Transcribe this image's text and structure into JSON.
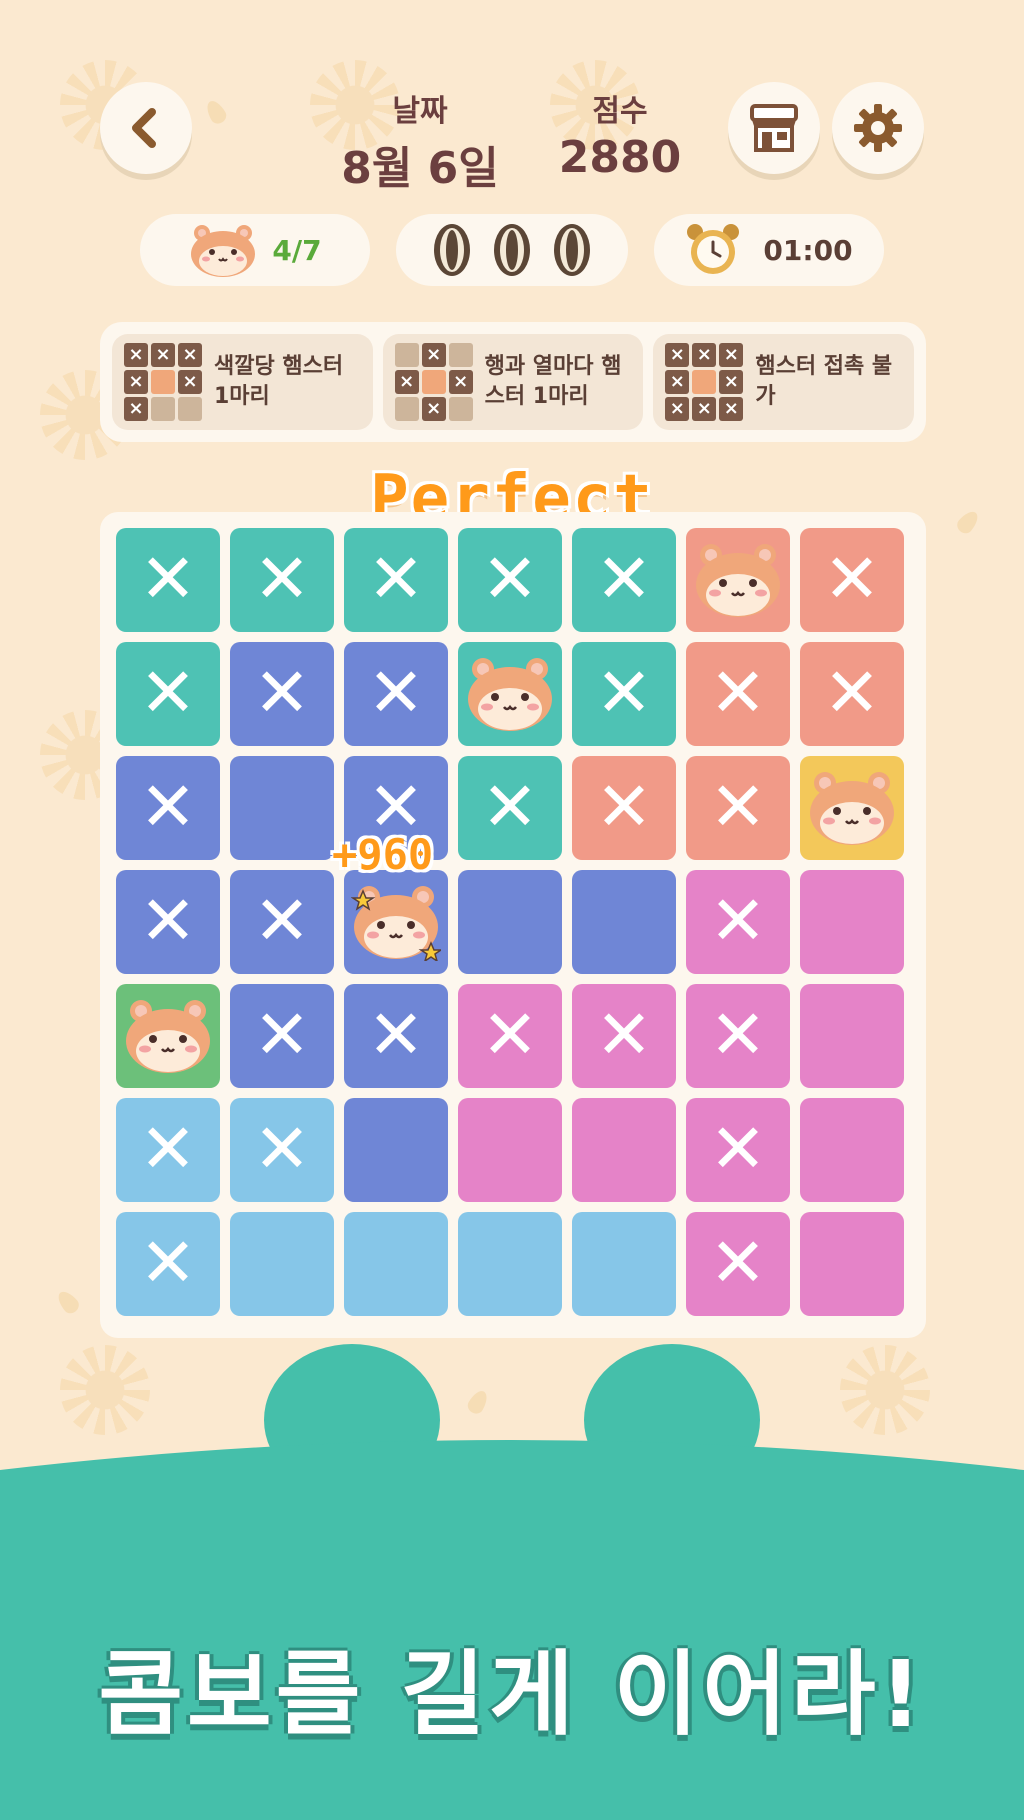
{
  "header": {
    "date_label": "날짜",
    "date_value": "8월 6일",
    "score_label": "점수",
    "score_value": "2880"
  },
  "icons": {
    "back": "chevron-left-icon",
    "shop": "shop-icon",
    "settings": "gear-icon",
    "hamster": "hamster-icon",
    "seed": "sunflower-seed-icon",
    "clock": "alarm-clock-icon"
  },
  "status": {
    "hamsters_found": "4/7",
    "seeds_remaining": 3,
    "timer": "01:00"
  },
  "rules": [
    {
      "text": "색깔당 햄스터 1마리"
    },
    {
      "text": "행과 열마다 햄스터 1마리"
    },
    {
      "text": "햄스터 접촉 불가"
    }
  ],
  "feedback": {
    "perfect": "Perfect",
    "combo_score": "+960"
  },
  "colors": {
    "teal": "#4ec2b4",
    "blue": "#6f86d6",
    "salmon": "#f19a88",
    "pink": "#e583c8",
    "lightblue": "#86c6e8",
    "yellow": "#f3c85a",
    "green": "#6cc07a",
    "bottom_teal": "#45bfaa"
  },
  "board": {
    "size": 7,
    "cells": [
      [
        {
          "c": "teal",
          "m": "x"
        },
        {
          "c": "teal",
          "m": "x"
        },
        {
          "c": "teal",
          "m": "x"
        },
        {
          "c": "teal",
          "m": "x"
        },
        {
          "c": "teal",
          "m": "x"
        },
        {
          "c": "salmon",
          "m": "hamster"
        },
        {
          "c": "salmon",
          "m": "x"
        }
      ],
      [
        {
          "c": "teal",
          "m": "x"
        },
        {
          "c": "blue",
          "m": "x"
        },
        {
          "c": "blue",
          "m": "x"
        },
        {
          "c": "teal",
          "m": "hamster"
        },
        {
          "c": "teal",
          "m": "x"
        },
        {
          "c": "salmon",
          "m": "x"
        },
        {
          "c": "salmon",
          "m": "x"
        }
      ],
      [
        {
          "c": "blue",
          "m": "x"
        },
        {
          "c": "blue",
          "m": ""
        },
        {
          "c": "blue",
          "m": "x"
        },
        {
          "c": "teal",
          "m": "x"
        },
        {
          "c": "salmon",
          "m": "x"
        },
        {
          "c": "salmon",
          "m": "x"
        },
        {
          "c": "yellow",
          "m": "hamster"
        }
      ],
      [
        {
          "c": "blue",
          "m": "x"
        },
        {
          "c": "blue",
          "m": "x"
        },
        {
          "c": "blue",
          "m": "hamster-star"
        },
        {
          "c": "blue",
          "m": ""
        },
        {
          "c": "blue",
          "m": ""
        },
        {
          "c": "pink",
          "m": "x"
        },
        {
          "c": "pink",
          "m": ""
        }
      ],
      [
        {
          "c": "green",
          "m": "hamster"
        },
        {
          "c": "blue",
          "m": "x"
        },
        {
          "c": "blue",
          "m": "x"
        },
        {
          "c": "pink",
          "m": "x"
        },
        {
          "c": "pink",
          "m": "x"
        },
        {
          "c": "pink",
          "m": "x"
        },
        {
          "c": "pink",
          "m": ""
        }
      ],
      [
        {
          "c": "lightblue",
          "m": "x"
        },
        {
          "c": "lightblue",
          "m": "x"
        },
        {
          "c": "blue",
          "m": ""
        },
        {
          "c": "pink",
          "m": ""
        },
        {
          "c": "pink",
          "m": ""
        },
        {
          "c": "pink",
          "m": "x"
        },
        {
          "c": "pink",
          "m": ""
        }
      ],
      [
        {
          "c": "lightblue",
          "m": "x"
        },
        {
          "c": "lightblue",
          "m": ""
        },
        {
          "c": "lightblue",
          "m": ""
        },
        {
          "c": "lightblue",
          "m": ""
        },
        {
          "c": "lightblue",
          "m": ""
        },
        {
          "c": "pink",
          "m": "x"
        },
        {
          "c": "pink",
          "m": ""
        }
      ]
    ]
  },
  "banner": "콤보를 길게 이어라!"
}
